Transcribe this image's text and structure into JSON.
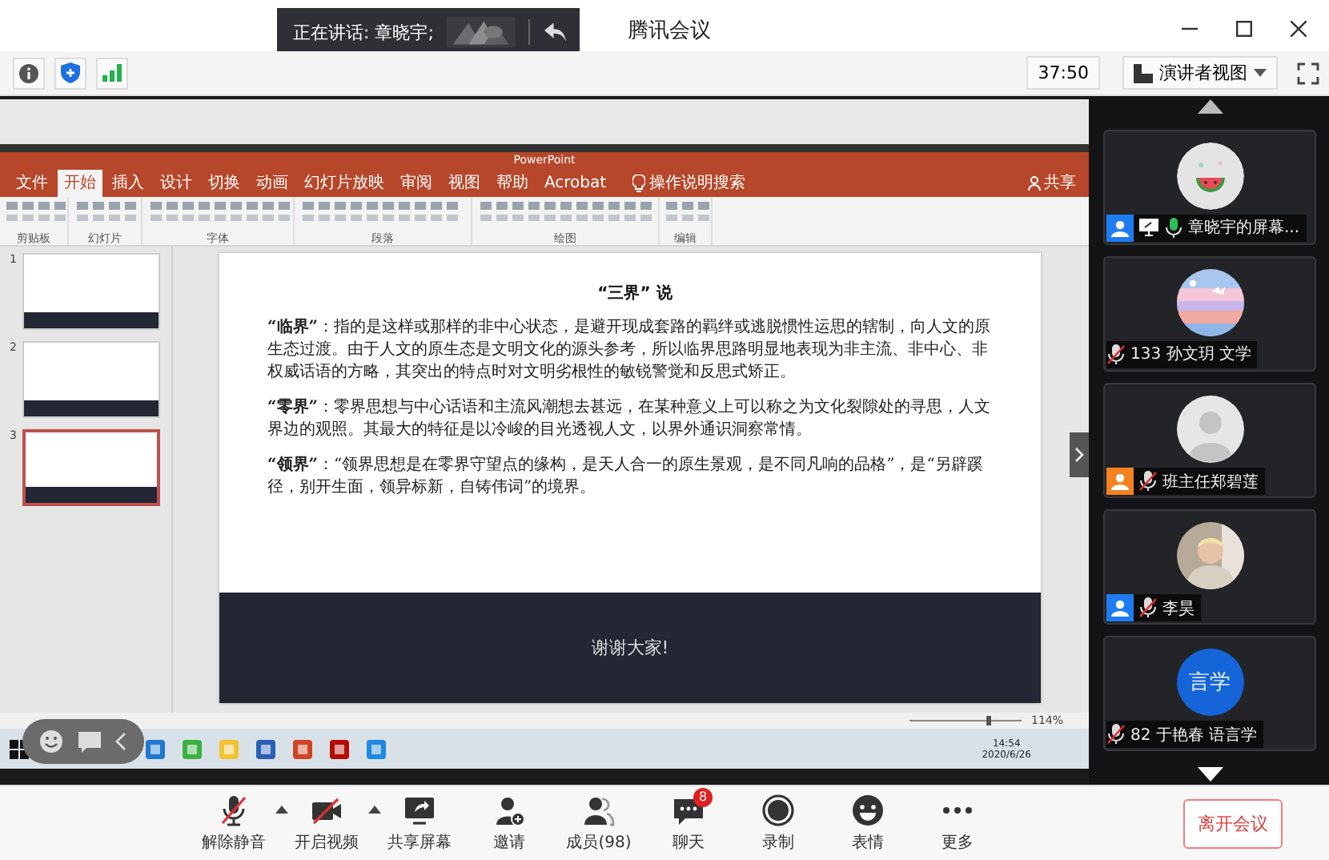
{
  "window": {
    "title": "腾讯会议"
  },
  "speaking": {
    "text": "正在讲话: 章晓宇;"
  },
  "info_bar": {
    "timer": "37:50",
    "view_mode": "演讲者视图"
  },
  "shared_screen": {
    "app_title": "PowerPoint",
    "ribbon_tabs": [
      {
        "label": "文件",
        "selected": false
      },
      {
        "label": "开始",
        "selected": true
      },
      {
        "label": "插入",
        "selected": false
      },
      {
        "label": "设计",
        "selected": false
      },
      {
        "label": "切换",
        "selected": false
      },
      {
        "label": "动画",
        "selected": false
      },
      {
        "label": "幻灯片放映",
        "selected": false
      },
      {
        "label": "审阅",
        "selected": false
      },
      {
        "label": "视图",
        "selected": false
      },
      {
        "label": "帮助",
        "selected": false
      },
      {
        "label": "Acrobat",
        "selected": false
      }
    ],
    "tell_me": "操作说明搜索",
    "share": "共享",
    "ribbon_groups": [
      "剪贴板",
      "幻灯片",
      "字体",
      "段落",
      "绘图",
      "编辑"
    ],
    "thumbnails": [
      {
        "number": "1",
        "selected": false
      },
      {
        "number": "2",
        "selected": false
      },
      {
        "number": "3",
        "selected": true
      }
    ],
    "slide": {
      "title": "“三界” 说",
      "paragraphs": [
        "**“临界”**：指的是这样或那样的非中心状态，是避开现成套路的羁绊或逃脱惯性运思的辖制，向人文的原生态过渡。由于人文的原生态是文明文化的源头参考，所以临界思路明显地表现为非主流、非中心、非权威话语的方略，其突出的特点时对文明劣根性的敏锐警觉和反思式矫正。",
        "**“零界”**：零界思想与中心话语和主流风潮想去甚远，在某种意义上可以称之为文化裂隙处的寻思，人文界边的观照。其最大的特征是以冷峻的目光透视人文，以界外通识洞察常情。",
        "**“领界”**：“领界思想是在零界守望点的缘构，是天人合一的原生景观，是不同凡响的品格”，是“另辟蹊径，别开生面，领异标新，自铸伟词”的境界。"
      ],
      "footer": "谢谢大家!"
    },
    "zoom": "114%",
    "clock": {
      "time": "14:54",
      "date": "2020/6/26"
    }
  },
  "participants": [
    {
      "name": "章晓宇的屏幕...",
      "color": "#1e7cf2",
      "sharing": true,
      "muted": false
    },
    {
      "name": "133 孙文玥 文学",
      "sharing": false,
      "muted": true
    },
    {
      "name": "班主任郑碧莲",
      "color": "#f5821f",
      "sharing": false,
      "muted": true,
      "avatar": {
        "kind": "default"
      }
    },
    {
      "name": "李昊",
      "color": "#1e7cf2",
      "sharing": false,
      "muted": true
    },
    {
      "name": "82 于艳春 语言学",
      "sharing": false,
      "muted": true,
      "avatar": {
        "kind": "initials",
        "text": "言学"
      }
    }
  ],
  "toolbar": [
    {
      "label": "解除静音",
      "caret": true
    },
    {
      "label": "开启视频",
      "caret": true
    },
    {
      "label": "共享屏幕",
      "caret": false
    },
    {
      "label": "邀请",
      "caret": false
    },
    {
      "label": "成员(98)",
      "caret": false
    },
    {
      "label": "聊天",
      "caret": false,
      "badge": "8"
    },
    {
      "label": "录制",
      "caret": false
    },
    {
      "label": "表情",
      "caret": false
    },
    {
      "label": "更多",
      "caret": false
    }
  ],
  "leave_button": "离开会议"
}
